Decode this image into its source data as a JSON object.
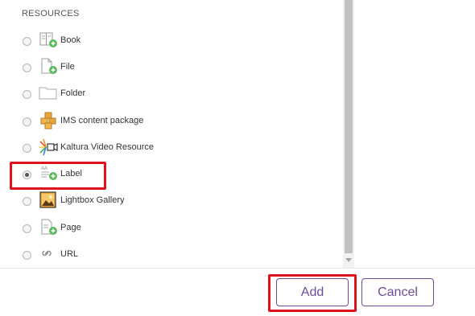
{
  "section_title": "RESOURCES",
  "resources": [
    {
      "label": "Book",
      "icon": "book-icon",
      "selected": false
    },
    {
      "label": "File",
      "icon": "file-icon",
      "selected": false
    },
    {
      "label": "Folder",
      "icon": "folder-icon",
      "selected": false
    },
    {
      "label": "IMS content package",
      "icon": "ims-package-icon",
      "selected": false
    },
    {
      "label": "Kaltura Video Resource",
      "icon": "kaltura-video-icon",
      "selected": false
    },
    {
      "label": "Label",
      "icon": "label-icon",
      "selected": true
    },
    {
      "label": "Lightbox Gallery",
      "icon": "lightbox-gallery-icon",
      "selected": false
    },
    {
      "label": "Page",
      "icon": "page-icon",
      "selected": false
    },
    {
      "label": "URL",
      "icon": "url-link-icon",
      "selected": false
    }
  ],
  "buttons": {
    "add_label": "Add",
    "cancel_label": "Cancel"
  },
  "colors": {
    "accent": "#6b4c9a",
    "highlight": "#e0131c",
    "add_plus": "#5cb85c"
  }
}
